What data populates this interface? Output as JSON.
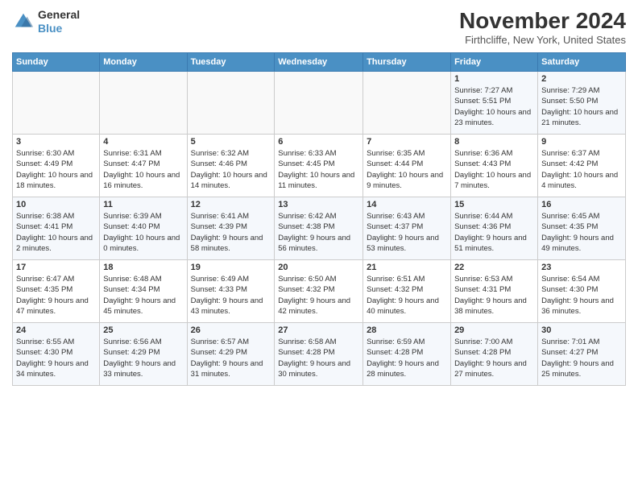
{
  "logo": {
    "line1": "General",
    "line2": "Blue"
  },
  "title": "November 2024",
  "location": "Firthcliffe, New York, United States",
  "days_of_week": [
    "Sunday",
    "Monday",
    "Tuesday",
    "Wednesday",
    "Thursday",
    "Friday",
    "Saturday"
  ],
  "weeks": [
    [
      {
        "day": "",
        "info": ""
      },
      {
        "day": "",
        "info": ""
      },
      {
        "day": "",
        "info": ""
      },
      {
        "day": "",
        "info": ""
      },
      {
        "day": "",
        "info": ""
      },
      {
        "day": "1",
        "info": "Sunrise: 7:27 AM\nSunset: 5:51 PM\nDaylight: 10 hours and 23 minutes."
      },
      {
        "day": "2",
        "info": "Sunrise: 7:29 AM\nSunset: 5:50 PM\nDaylight: 10 hours and 21 minutes."
      }
    ],
    [
      {
        "day": "3",
        "info": "Sunrise: 6:30 AM\nSunset: 4:49 PM\nDaylight: 10 hours and 18 minutes."
      },
      {
        "day": "4",
        "info": "Sunrise: 6:31 AM\nSunset: 4:47 PM\nDaylight: 10 hours and 16 minutes."
      },
      {
        "day": "5",
        "info": "Sunrise: 6:32 AM\nSunset: 4:46 PM\nDaylight: 10 hours and 14 minutes."
      },
      {
        "day": "6",
        "info": "Sunrise: 6:33 AM\nSunset: 4:45 PM\nDaylight: 10 hours and 11 minutes."
      },
      {
        "day": "7",
        "info": "Sunrise: 6:35 AM\nSunset: 4:44 PM\nDaylight: 10 hours and 9 minutes."
      },
      {
        "day": "8",
        "info": "Sunrise: 6:36 AM\nSunset: 4:43 PM\nDaylight: 10 hours and 7 minutes."
      },
      {
        "day": "9",
        "info": "Sunrise: 6:37 AM\nSunset: 4:42 PM\nDaylight: 10 hours and 4 minutes."
      }
    ],
    [
      {
        "day": "10",
        "info": "Sunrise: 6:38 AM\nSunset: 4:41 PM\nDaylight: 10 hours and 2 minutes."
      },
      {
        "day": "11",
        "info": "Sunrise: 6:39 AM\nSunset: 4:40 PM\nDaylight: 10 hours and 0 minutes."
      },
      {
        "day": "12",
        "info": "Sunrise: 6:41 AM\nSunset: 4:39 PM\nDaylight: 9 hours and 58 minutes."
      },
      {
        "day": "13",
        "info": "Sunrise: 6:42 AM\nSunset: 4:38 PM\nDaylight: 9 hours and 56 minutes."
      },
      {
        "day": "14",
        "info": "Sunrise: 6:43 AM\nSunset: 4:37 PM\nDaylight: 9 hours and 53 minutes."
      },
      {
        "day": "15",
        "info": "Sunrise: 6:44 AM\nSunset: 4:36 PM\nDaylight: 9 hours and 51 minutes."
      },
      {
        "day": "16",
        "info": "Sunrise: 6:45 AM\nSunset: 4:35 PM\nDaylight: 9 hours and 49 minutes."
      }
    ],
    [
      {
        "day": "17",
        "info": "Sunrise: 6:47 AM\nSunset: 4:35 PM\nDaylight: 9 hours and 47 minutes."
      },
      {
        "day": "18",
        "info": "Sunrise: 6:48 AM\nSunset: 4:34 PM\nDaylight: 9 hours and 45 minutes."
      },
      {
        "day": "19",
        "info": "Sunrise: 6:49 AM\nSunset: 4:33 PM\nDaylight: 9 hours and 43 minutes."
      },
      {
        "day": "20",
        "info": "Sunrise: 6:50 AM\nSunset: 4:32 PM\nDaylight: 9 hours and 42 minutes."
      },
      {
        "day": "21",
        "info": "Sunrise: 6:51 AM\nSunset: 4:32 PM\nDaylight: 9 hours and 40 minutes."
      },
      {
        "day": "22",
        "info": "Sunrise: 6:53 AM\nSunset: 4:31 PM\nDaylight: 9 hours and 38 minutes."
      },
      {
        "day": "23",
        "info": "Sunrise: 6:54 AM\nSunset: 4:30 PM\nDaylight: 9 hours and 36 minutes."
      }
    ],
    [
      {
        "day": "24",
        "info": "Sunrise: 6:55 AM\nSunset: 4:30 PM\nDaylight: 9 hours and 34 minutes."
      },
      {
        "day": "25",
        "info": "Sunrise: 6:56 AM\nSunset: 4:29 PM\nDaylight: 9 hours and 33 minutes."
      },
      {
        "day": "26",
        "info": "Sunrise: 6:57 AM\nSunset: 4:29 PM\nDaylight: 9 hours and 31 minutes."
      },
      {
        "day": "27",
        "info": "Sunrise: 6:58 AM\nSunset: 4:28 PM\nDaylight: 9 hours and 30 minutes."
      },
      {
        "day": "28",
        "info": "Sunrise: 6:59 AM\nSunset: 4:28 PM\nDaylight: 9 hours and 28 minutes."
      },
      {
        "day": "29",
        "info": "Sunrise: 7:00 AM\nSunset: 4:28 PM\nDaylight: 9 hours and 27 minutes."
      },
      {
        "day": "30",
        "info": "Sunrise: 7:01 AM\nSunset: 4:27 PM\nDaylight: 9 hours and 25 minutes."
      }
    ]
  ]
}
